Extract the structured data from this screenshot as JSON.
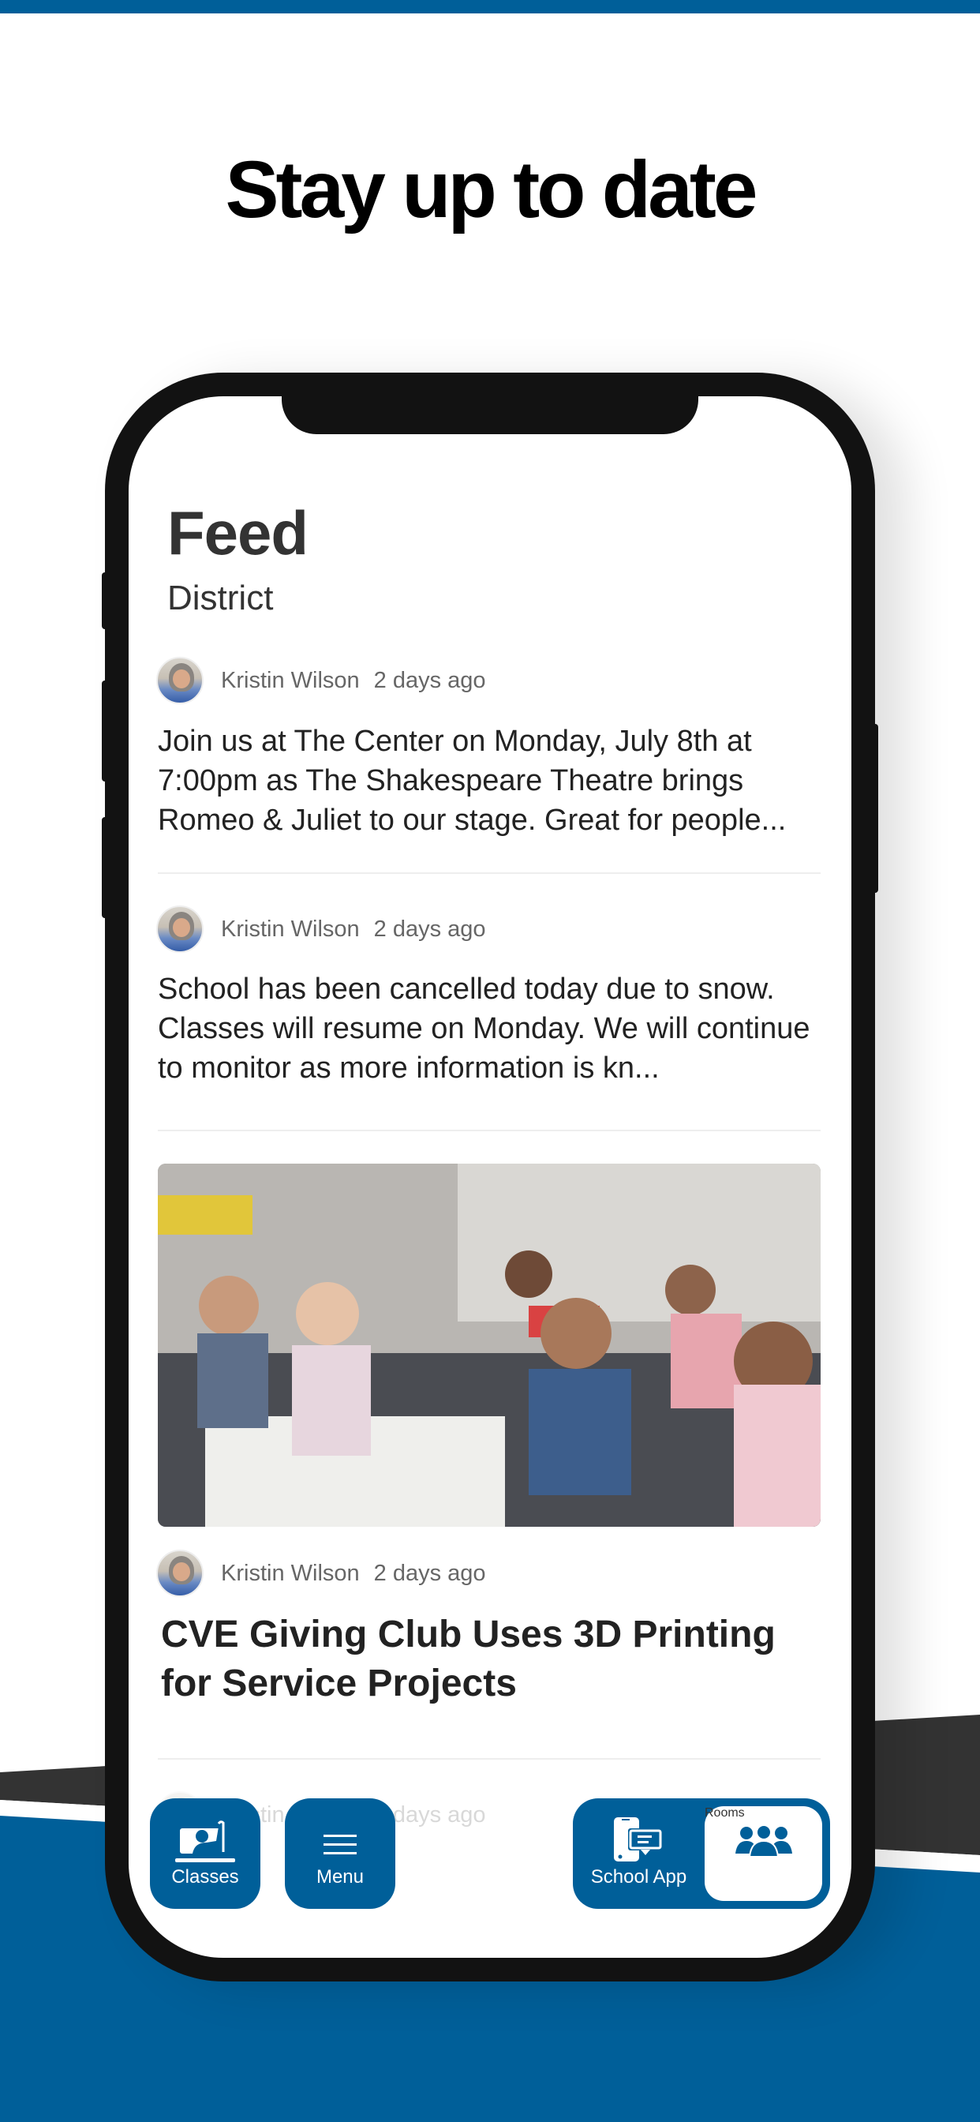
{
  "headline": "Stay up to date",
  "colors": {
    "brand_blue": "#005f99",
    "dark_band": "#333333",
    "phone_frame": "#121212",
    "text_primary": "#333333",
    "text_meta": "#666666"
  },
  "screen": {
    "title": "Feed",
    "subtitle": "District",
    "posts": [
      {
        "author": "Kristin Wilson",
        "time": "2 days ago",
        "body": "Join us at The Center on Monday, July 8th at 7:00pm as The Shakespeare Theatre brings Romeo & Juliet to our stage. Great for people...",
        "avatar_icon": "avatar-photo"
      },
      {
        "author": "Kristin Wilson",
        "time": "2 days ago",
        "body": "School has been cancelled today due to snow. Classes will resume on Monday. We will continue to monitor as more information is kn...",
        "avatar_icon": "avatar-photo"
      },
      {
        "author": "Kristin Wilson",
        "time": "2 days ago",
        "image_alt": "Classroom of children raising hands",
        "headline": "CVE Giving Club Uses 3D Printing for Service Projects",
        "avatar_icon": "avatar-photo"
      },
      {
        "author": "Kristin Wilson",
        "time": "2 days ago",
        "avatar_icon": "avatar-photo"
      }
    ]
  },
  "nav": {
    "classes": {
      "label": "Classes",
      "icon": "raised-hand-icon"
    },
    "menu": {
      "label": "Menu",
      "icon": "hamburger-icon"
    },
    "school_app": {
      "label": "School App",
      "icon": "phone-message-icon"
    },
    "rooms": {
      "label": "Rooms",
      "icon": "group-icon",
      "selected": true
    }
  }
}
